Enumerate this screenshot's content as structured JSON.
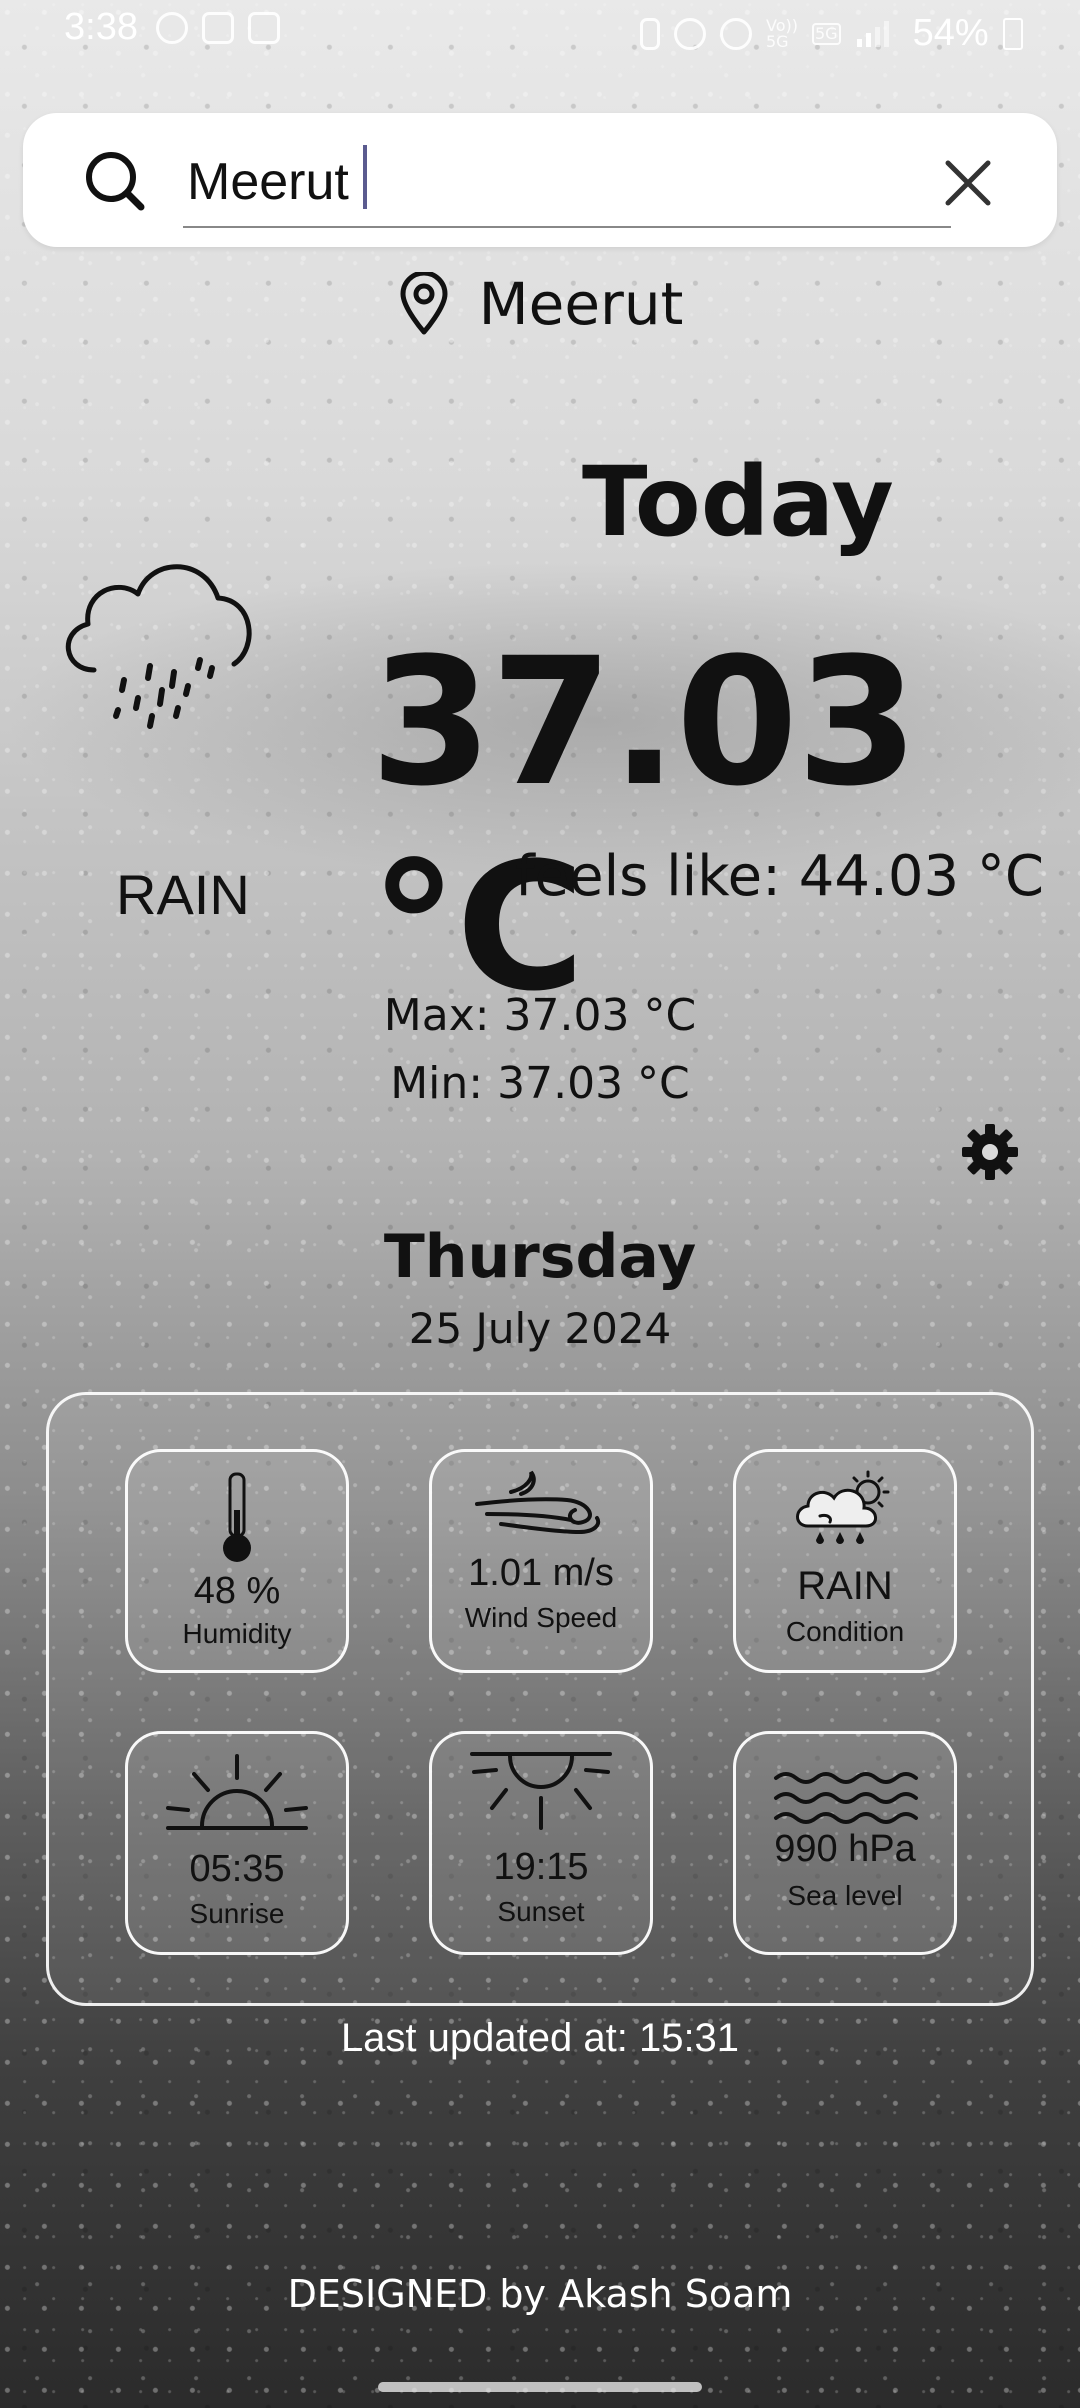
{
  "status_bar": {
    "time": "3:38",
    "battery": "54%",
    "network_small_1": "Vo))",
    "network_small_2": "5G",
    "signal_badge": "5G"
  },
  "search": {
    "value": "Meerut",
    "placeholder": ""
  },
  "location": {
    "name": "Meerut"
  },
  "current": {
    "heading": "Today",
    "temperature": "37.03 °C",
    "feels_like": "feels like: 44.03 °C",
    "condition": "RAIN",
    "max": "Max: 37.03 °C",
    "min": "Min: 37.03 °C"
  },
  "date": {
    "day": "Thursday",
    "full": "25 July 2024"
  },
  "details": [
    {
      "value": "48 %",
      "label": "Humidity",
      "icon": "thermometer-icon"
    },
    {
      "value": "1.01 m/s",
      "label": "Wind Speed",
      "icon": "wind-icon"
    },
    {
      "value": "RAIN",
      "label": "Condition",
      "icon": "cloud-sun-rain-icon"
    },
    {
      "value": "05:35",
      "label": "Sunrise",
      "icon": "sunrise-icon"
    },
    {
      "value": "19:15",
      "label": "Sunset",
      "icon": "sunset-icon"
    },
    {
      "value": "990 hPa",
      "label": "Sea level",
      "icon": "waves-icon"
    }
  ],
  "footer": {
    "last_updated": "Last updated at: 15:31",
    "credit": "DESIGNED by Akash Soam"
  }
}
